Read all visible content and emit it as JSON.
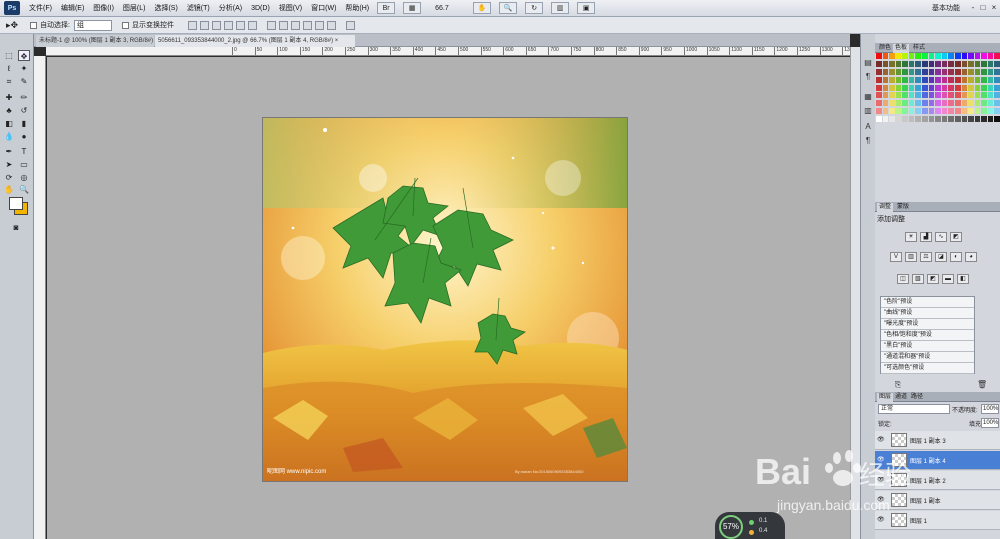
{
  "app": {
    "logo_text": "Ps",
    "menus": [
      "文件(F)",
      "编辑(E)",
      "图像(I)",
      "图层(L)",
      "选择(S)",
      "滤镜(T)",
      "分析(A)",
      "3D(D)",
      "视图(V)",
      "窗口(W)",
      "帮助(H)"
    ],
    "zoom": "66.7",
    "workspace": "基本功能",
    "window_controls": [
      "-",
      "□",
      "×"
    ]
  },
  "options": {
    "auto_select_label": "自动选择:",
    "auto_select_value": "组",
    "show_transform_label": "显示变换控件"
  },
  "tabs": [
    {
      "label": "未标题-1 @ 100% (图层 1 副本 3, RGB/8#) ×"
    },
    {
      "label": "5056611_093353844000_2.jpg @ 66.7% (图层 1 副本 4, RGB/8#) ×"
    }
  ],
  "ruler_ticks": [
    "0",
    "50",
    "100",
    "150",
    "200",
    "250",
    "300",
    "350",
    "400",
    "450",
    "500",
    "550",
    "600",
    "650",
    "700",
    "750",
    "800",
    "850",
    "900",
    "950",
    "1000",
    "1050",
    "1100",
    "1150",
    "1200",
    "1250",
    "1300",
    "1350",
    "1400",
    "1450",
    "1500",
    "1550",
    "1600",
    "1650"
  ],
  "image": {
    "watermark_left": "昵图网 www.nipic.com",
    "watermark_right": "By:nsean No:20150609093353844000"
  },
  "panels": {
    "color_tabs": [
      "颜色",
      "色板",
      "样式"
    ],
    "adjust_tabs": [
      "调整",
      "蒙版"
    ],
    "adjust_title": "添加调整",
    "presets": [
      "\"色阶\"预设",
      "\"曲线\"预设",
      "\"曝光度\"预设",
      "\"色相/饱和度\"预设",
      "\"黑白\"预设",
      "\"通道混和器\"预设",
      "\"可选颜色\"预设"
    ],
    "layer_tabs": [
      "图层",
      "通道",
      "路径"
    ],
    "blend_mode": "正常",
    "opacity_label": "不透明度:",
    "opacity_value": "100%",
    "lock_label": "锁定:",
    "fill_label": "填充:",
    "fill_value": "100%",
    "layers": [
      {
        "name": "图层 1 副本 3",
        "selected": false
      },
      {
        "name": "图层 1 副本 4",
        "selected": true
      },
      {
        "name": "图层 1 副本 2",
        "selected": false
      },
      {
        "name": "图层 1 副本",
        "selected": false
      },
      {
        "name": "图层 1",
        "selected": false
      }
    ]
  },
  "speed": {
    "percent": "57%",
    "upload": "0.1",
    "download": "0.4"
  },
  "baidu": {
    "brand": "Bai",
    "brand2": "经验",
    "url": "jingyan.baidu.com"
  }
}
